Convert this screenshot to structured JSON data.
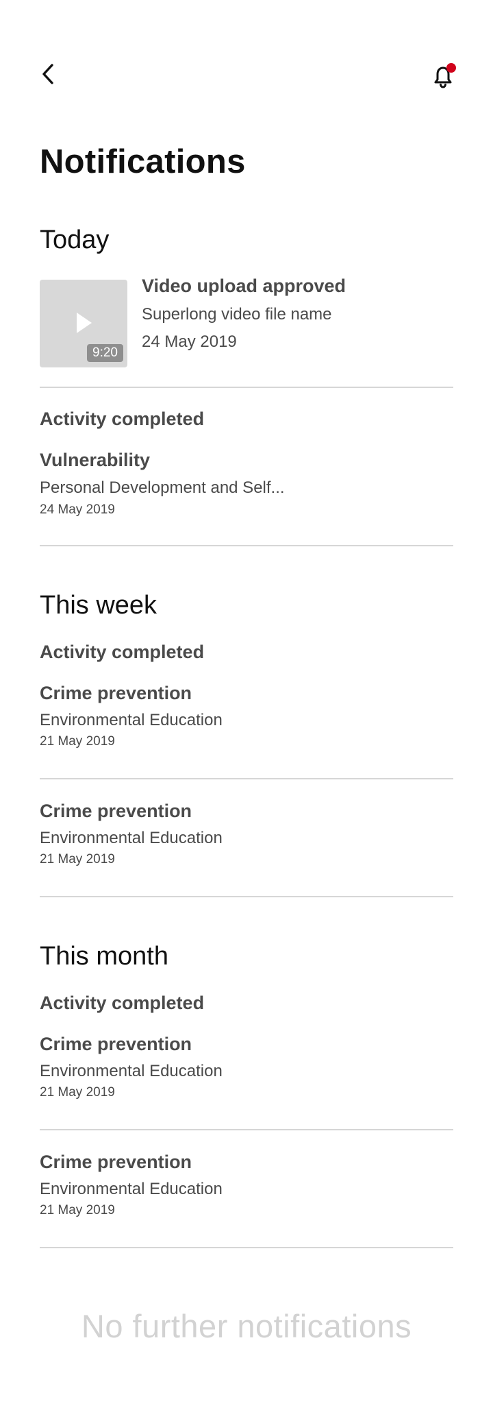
{
  "header": {
    "back_icon": "chevron-left-icon",
    "bell_icon": "bell-icon",
    "unread_dot_color": "#d0021b"
  },
  "title": "Notifications",
  "sections": [
    {
      "heading": "Today",
      "video": {
        "title": "Video upload approved",
        "file_name": "Superlong video file name",
        "date": "24 May 2019",
        "duration": "9:20",
        "play_icon": "play-icon"
      },
      "group_heading": "Activity completed",
      "items": [
        {
          "title": "Vulnerability",
          "subtitle": "Personal Development and Self...",
          "date": "24 May 2019"
        }
      ]
    },
    {
      "heading": "This week",
      "group_heading": "Activity completed",
      "items": [
        {
          "title": "Crime prevention",
          "subtitle": "Environmental Education",
          "date": "21 May 2019"
        },
        {
          "title": "Crime prevention",
          "subtitle": "Environmental Education",
          "date": "21 May 2019"
        }
      ]
    },
    {
      "heading": "This month",
      "group_heading": "Activity completed",
      "items": [
        {
          "title": "Crime prevention",
          "subtitle": "Environmental Education",
          "date": "21 May 2019"
        },
        {
          "title": "Crime prevention",
          "subtitle": "Environmental Education",
          "date": "21 May 2019"
        }
      ]
    }
  ],
  "footer_text": "No further notifications"
}
